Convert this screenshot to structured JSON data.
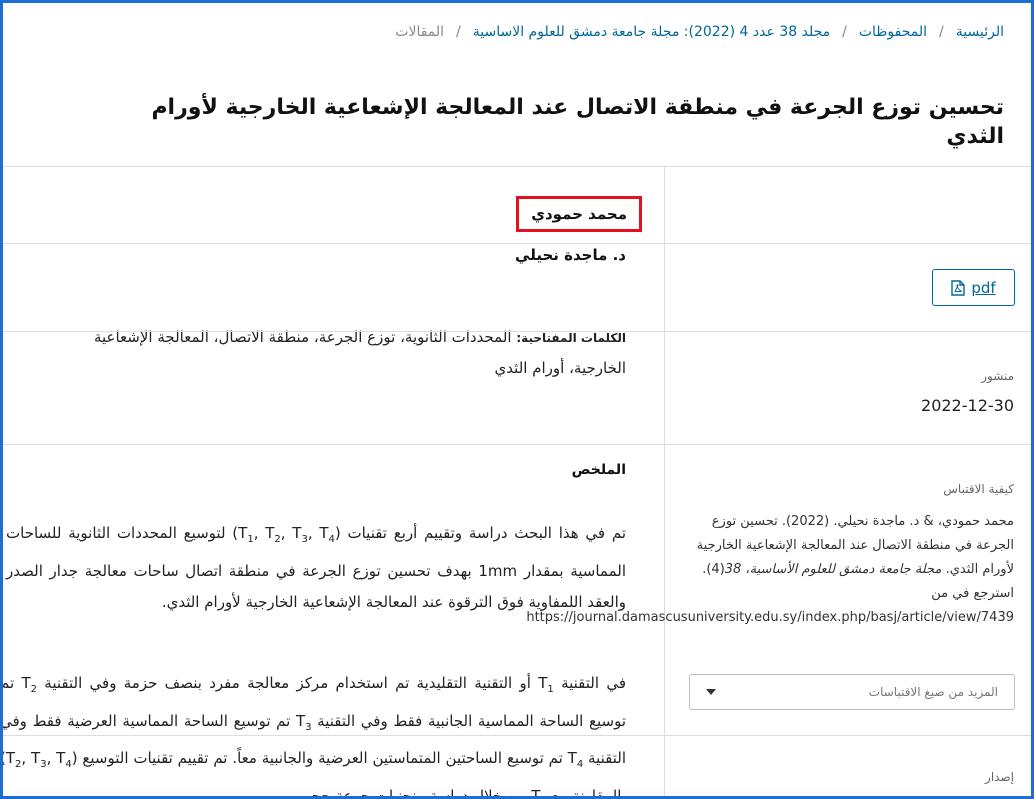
{
  "breadcrumb": {
    "home": "الرئيسية",
    "archives": "المحفوظات",
    "issue": "مجلد 38 عدد 4 (2022): مجلة جامعة دمشق للعلوم الاساسية",
    "current": "المقالات"
  },
  "article": {
    "title": "تحسين توزع الجرعة في منطقة الاتصال عند المعالجة الإشعاعية الخارجية لأورام الثدي",
    "authors": [
      "محمد حمودي",
      "د. ماجدة نحيلي"
    ],
    "keywords_label": "الكلمات المفتاحية:",
    "keywords_text": "المحددات الثانوية، توزع الجرعة، منطقة الاتصال، المعالجة الإشعاعية الخارجية، أورام الثدي",
    "abstract_heading": "الملخص"
  },
  "sidebar": {
    "pdf_label": "pdf",
    "published_label": "منشور",
    "published_date": "2022-12-30",
    "citation_label": "كيفية الاقتباس",
    "citation_authors": "محمد حمودي، & د. ماجدة نحيلي. (2022). تحسين توزع الجرعة في منطقة الاتصال عند المعالجة الإشعاعية الخارجية لأورام الثدي.",
    "citation_journal": "مجلة جامعة دمشق للعلوم الأساسية",
    "citation_volume": "38",
    "citation_issue": "(4). استرجع في من",
    "citation_url": "https://journal.damascusuniversity.edu.sy/index.php/basj/article/view/7439",
    "more_formats": "المزيد من صيغ الاقتباسات",
    "issue_label": "إصدار"
  }
}
